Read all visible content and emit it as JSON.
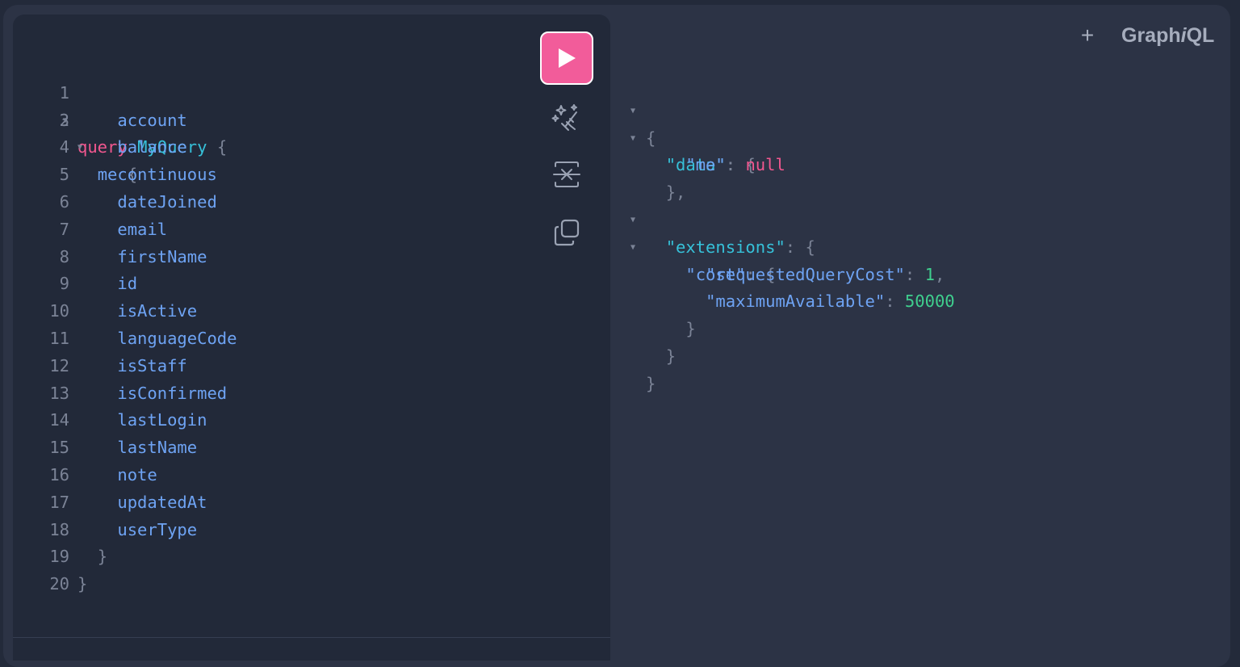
{
  "app": {
    "brand_prefix": "Graph",
    "brand_italic": "i",
    "brand_suffix": "QL",
    "add_tab_label": "+"
  },
  "colors": {
    "accent": "#f25c9a",
    "background": "#2c3345",
    "editor_bg": "#222939",
    "keyword": "#f2578f",
    "field": "#6ea3f3",
    "name": "#36c1d9",
    "number": "#3fcf8e"
  },
  "editor": {
    "query_keyword": "query",
    "operation_name": "MyQuery",
    "root_field": "me",
    "fields": [
      "account",
      "balance",
      "continuous",
      "dateJoined",
      "email",
      "firstName",
      "id",
      "isActive",
      "languageCode",
      "isStaff",
      "isConfirmed",
      "lastLogin",
      "lastName",
      "note",
      "updatedAt",
      "userType"
    ],
    "line_numbers": [
      "1",
      "2",
      "3",
      "4",
      "5",
      "6",
      "7",
      "8",
      "9",
      "10",
      "11",
      "12",
      "13",
      "14",
      "15",
      "16",
      "17",
      "18",
      "19",
      "20"
    ],
    "open_brace": "{",
    "close_brace": "}"
  },
  "toolbar": {
    "run_icon": "play-icon",
    "prettify_icon": "magic-wand-icon",
    "merge_icon": "merge-fragments-icon",
    "copy_icon": "copy-icon"
  },
  "result": {
    "data_key": "\"data\"",
    "me_key": "\"me\"",
    "me_value": "null",
    "extensions_key": "\"extensions\"",
    "cost_key": "\"cost\"",
    "requested_key": "\"requestedQueryCost\"",
    "requested_value": "1",
    "maximum_key": "\"maximumAvailable\"",
    "maximum_value": "50000"
  }
}
